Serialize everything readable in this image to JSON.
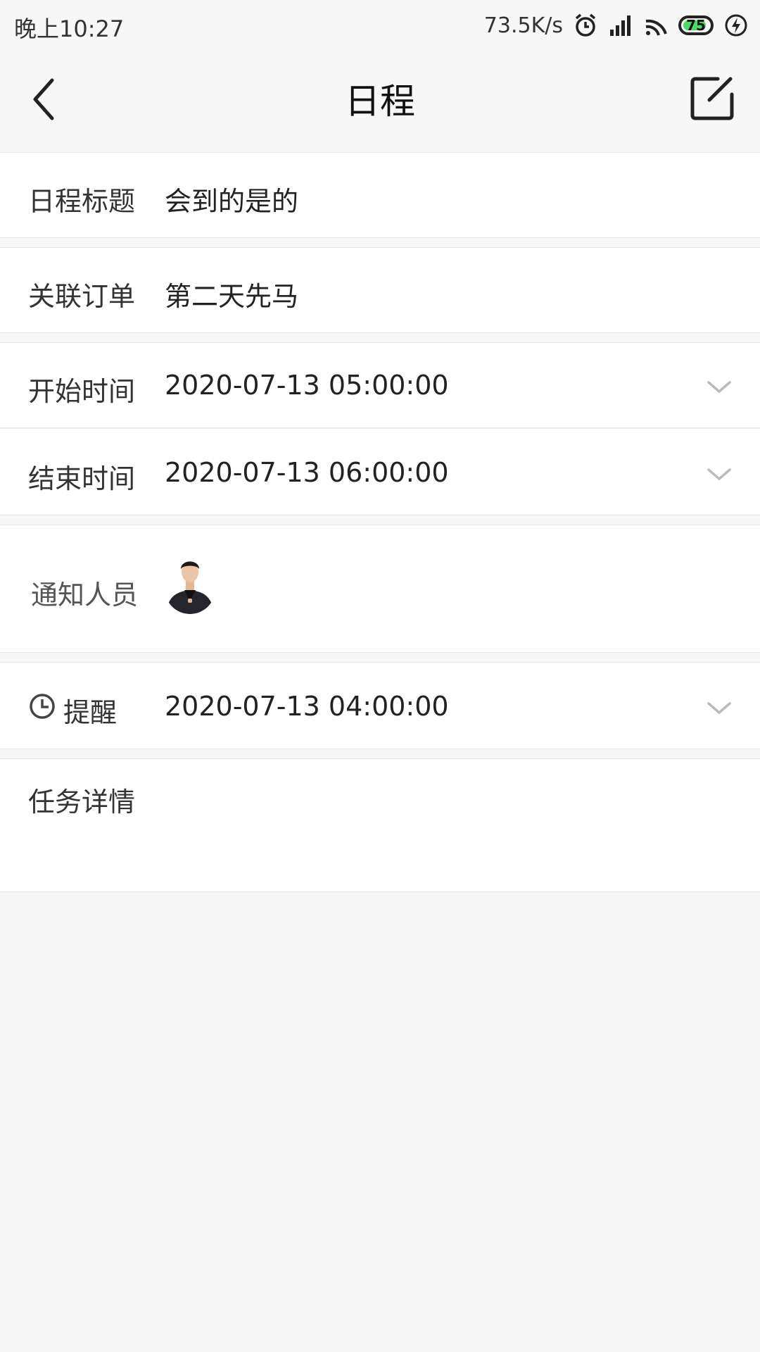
{
  "status_bar": {
    "time": "晚上10:27",
    "net_speed": "73.5K/s",
    "battery_level": "75",
    "icons": [
      "alarm-icon",
      "signal-icon",
      "wifi-icon",
      "battery-icon",
      "charging-icon"
    ],
    "battery_color": "#4cd964"
  },
  "nav": {
    "title": "日程",
    "back_icon": "chevron-left-icon",
    "edit_icon": "edit-icon"
  },
  "form": {
    "title_row": {
      "label": "日程标题",
      "value": "会到的是的"
    },
    "order_row": {
      "label": "关联订单",
      "value": "第二天先马"
    },
    "start_row": {
      "label": "开始时间",
      "value": "2020-07-13 05:00:00"
    },
    "end_row": {
      "label": "结束时间",
      "value": "2020-07-13 06:00:00"
    },
    "notify_row": {
      "label": "通知人员"
    },
    "reminder_row": {
      "label": "提醒",
      "value": "2020-07-13 04:00:00"
    },
    "details_row": {
      "label": "任务详情",
      "value": ""
    }
  }
}
